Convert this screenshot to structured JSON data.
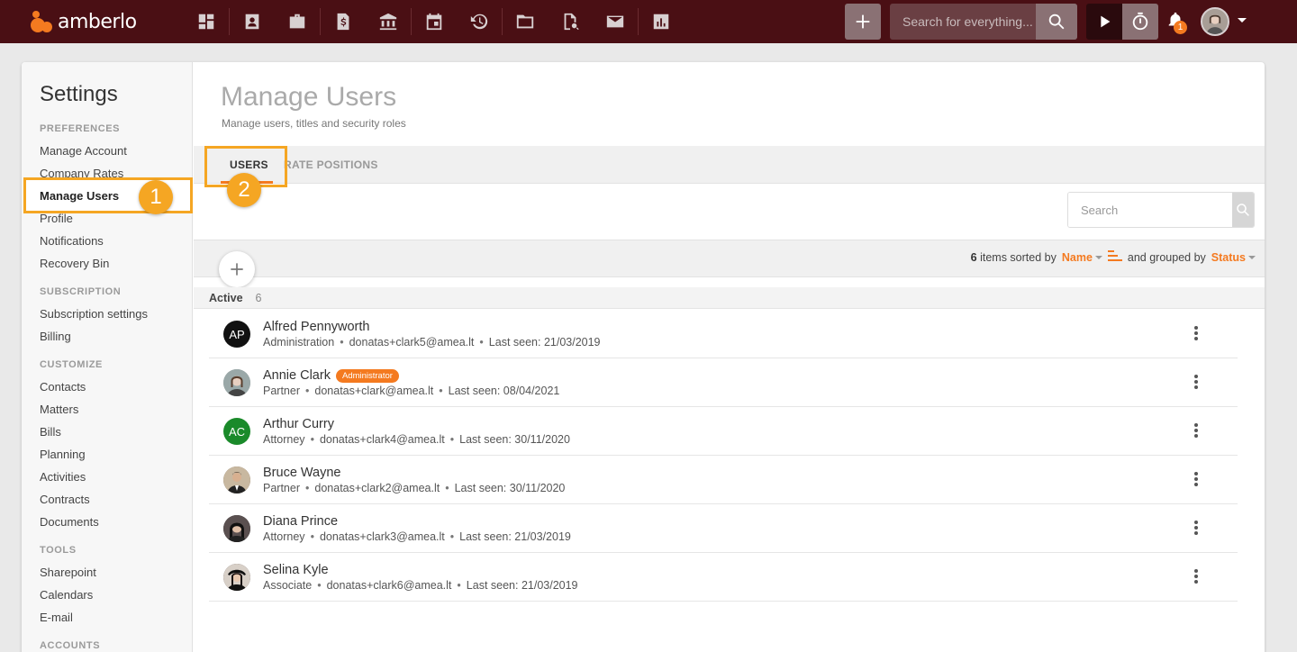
{
  "app": {
    "logo_text": "amberlo"
  },
  "topbar": {
    "nav_icons": [
      "dashboard-icon",
      "contacts-icon",
      "matters-icon",
      "bills-icon",
      "bank-icon",
      "calendar-icon",
      "history-icon",
      "folder-icon",
      "document-search-icon",
      "mail-icon",
      "reports-icon"
    ],
    "search_placeholder": "Search for everything...",
    "notifications_count": "1"
  },
  "sidebar": {
    "title": "Settings",
    "sections": [
      {
        "label": "PREFERENCES",
        "items": [
          "Manage Account",
          "Company Rates",
          "Manage Users",
          "Profile",
          "Notifications",
          "Recovery Bin"
        ]
      },
      {
        "label": "SUBSCRIPTION",
        "items": [
          "Subscription settings",
          "Billing"
        ]
      },
      {
        "label": "CUSTOMIZE",
        "items": [
          "Contacts",
          "Matters",
          "Bills",
          "Planning",
          "Activities",
          "Contracts",
          "Documents"
        ]
      },
      {
        "label": "TOOLS",
        "items": [
          "Sharepoint",
          "Calendars",
          "E-mail"
        ]
      },
      {
        "label": "ACCOUNTS",
        "items": []
      }
    ],
    "active_item": "Manage Users"
  },
  "markers": {
    "one": "1",
    "two": "2"
  },
  "main": {
    "title": "Manage Users",
    "subtitle": "Manage users, titles and security roles",
    "tabs": [
      {
        "label": "USERS",
        "active": true
      },
      {
        "label": "RATE POSITIONS",
        "active": false
      }
    ],
    "search_placeholder": "Search",
    "sort": {
      "count": "6",
      "items_sorted_by": "items sorted by",
      "sort_field": "Name",
      "grouped_by": "and grouped by",
      "group_field": "Status"
    },
    "group": {
      "name": "Active",
      "count": "6"
    },
    "users": [
      {
        "name": "Alfred Pennyworth",
        "initials": "AP",
        "avatar_color": "#111111",
        "title": "Administration",
        "email": "donatas+clark5@amea.lt",
        "last_seen": "Last seen: 21/03/2019",
        "badge": ""
      },
      {
        "name": "Annie Clark",
        "initials": "",
        "avatar_color": "#8a9a9a",
        "title": "Partner",
        "email": "donatas+clark@amea.lt",
        "last_seen": "Last seen: 08/04/2021",
        "badge": "Administrator"
      },
      {
        "name": "Arthur Curry",
        "initials": "AC",
        "avatar_color": "#1a8a2a",
        "title": "Attorney",
        "email": "donatas+clark4@amea.lt",
        "last_seen": "Last seen: 30/11/2020",
        "badge": ""
      },
      {
        "name": "Bruce Wayne",
        "initials": "",
        "avatar_color": "#6b5a48",
        "title": "Partner",
        "email": "donatas+clark2@amea.lt",
        "last_seen": "Last seen: 30/11/2020",
        "badge": ""
      },
      {
        "name": "Diana Prince",
        "initials": "",
        "avatar_color": "#2a2a2a",
        "title": "Attorney",
        "email": "donatas+clark3@amea.lt",
        "last_seen": "Last seen: 21/03/2019",
        "badge": ""
      },
      {
        "name": "Selina Kyle",
        "initials": "",
        "avatar_color": "#3a2a2a",
        "title": "Associate",
        "email": "donatas+clark6@amea.lt",
        "last_seen": "Last seen: 21/03/2019",
        "badge": ""
      }
    ]
  },
  "colors": {
    "topbar": "#4a0f14",
    "accent": "#f47a20",
    "highlight": "#f5a623"
  }
}
